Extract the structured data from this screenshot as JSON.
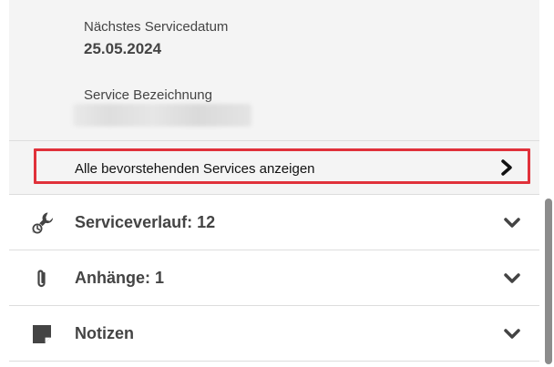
{
  "service_info": {
    "next_date_label": "Nächstes Servicedatum",
    "next_date_value": "25.05.2024",
    "name_label": "Service Bezeichnung"
  },
  "upcoming_link": {
    "label": "Alle bevorstehenden Services anzeigen",
    "icon": "chevron-right-icon"
  },
  "accordion": [
    {
      "label": "Serviceverlauf: 12",
      "icon": "wrench-history-icon"
    },
    {
      "label": "Anhänge: 1",
      "icon": "paperclip-icon"
    },
    {
      "label": "Notizen",
      "icon": "note-icon"
    }
  ],
  "colors": {
    "highlight": "#e0313a",
    "panel_bg": "#f4f4f4",
    "text": "#444444"
  }
}
